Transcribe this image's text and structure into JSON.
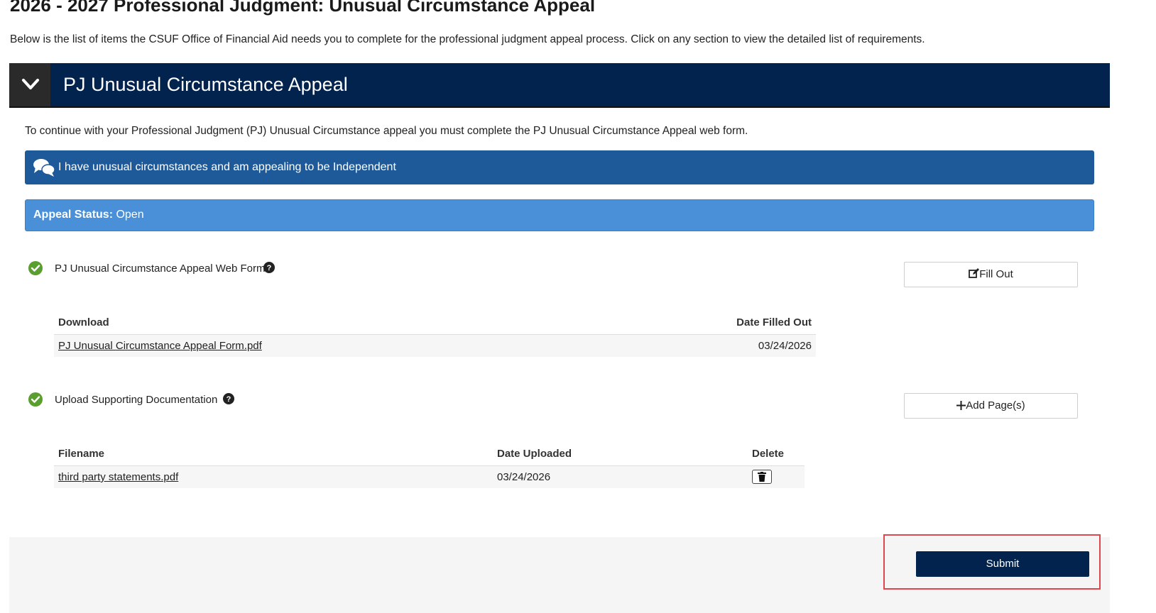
{
  "page": {
    "title": "2026 - 2027 Professional Judgment: Unusual Circumstance Appeal",
    "intro": "Below is the list of items the CSUF Office of Financial Aid needs you to complete for the professional judgment appeal process. Click on any section to view the detailed list of requirements."
  },
  "section": {
    "title": "PJ Unusual Circumstance Appeal",
    "toggle_icon": "chevron-down-icon",
    "description": "To continue with your Professional Judgment (PJ) Unusual Circumstance appeal you must complete the PJ Unusual Circumstance Appeal web form."
  },
  "appeal_banner": {
    "icon": "chat-bubbles-icon",
    "text": "I have unusual circumstances and am appealing to be Independent"
  },
  "status": {
    "label": "Appeal Status:",
    "value": " Open"
  },
  "requirements": [
    {
      "label": "PJ Unusual Circumstance Appeal Web Form",
      "status_icon": "check-circle-icon",
      "action_label": "Fill Out",
      "action_icon": "edit-icon",
      "table": {
        "headers": [
          "Download",
          "Date Filled Out"
        ],
        "rows": [
          {
            "file": "PJ Unusual Circumstance Appeal Form.pdf",
            "date": "03/24/2026"
          }
        ]
      }
    },
    {
      "label": "Upload Supporting Documentation",
      "status_icon": "check-circle-icon",
      "action_label": "Add Page(s)",
      "action_icon": "plus-icon",
      "table": {
        "headers": [
          "Filename",
          "Date Uploaded",
          "Delete"
        ],
        "rows": [
          {
            "file": "third party statements.pdf",
            "date": "03/24/2026",
            "delete_icon": "trash-icon"
          }
        ]
      }
    }
  ],
  "footer": {
    "submit_label": "Submit"
  },
  "colors": {
    "navy": "#01234d",
    "banner_blue": "#1e5a9a",
    "status_blue": "#4a90d9",
    "check_green": "#5a9e2f",
    "highlight_red": "#e0474c"
  }
}
